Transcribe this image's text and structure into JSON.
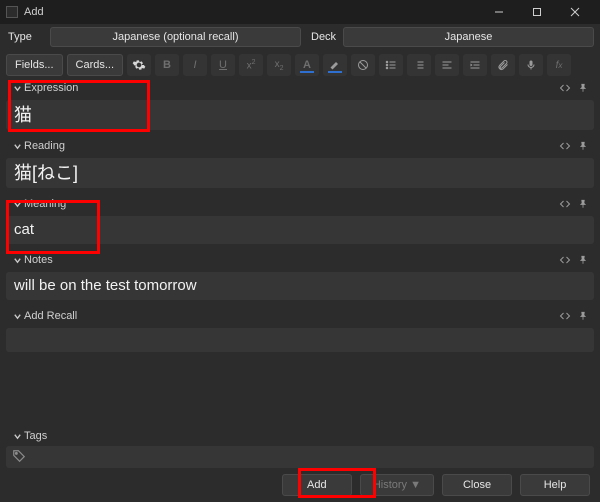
{
  "window": {
    "title": "Add",
    "min_tooltip": "Minimize",
    "max_tooltip": "Maximize",
    "close_tooltip": "Close"
  },
  "typedeck": {
    "type_label": "Type",
    "type_value": "Japanese (optional recall)",
    "deck_label": "Deck",
    "deck_value": "Japanese"
  },
  "toolbar": {
    "fields_label": "Fields...",
    "cards_label": "Cards...",
    "icons": {
      "settings": "gear",
      "bold": "B",
      "italic": "I",
      "underline": "U",
      "super": "x²",
      "sub": "x₂",
      "textcolor": "A",
      "highlight": "✎",
      "eraser": "eraser",
      "ul": "ul",
      "ol": "ol",
      "align": "align",
      "indent": "indent",
      "attach": "clip",
      "mic": "mic",
      "fx": "fx"
    }
  },
  "fields": [
    {
      "label": "Expression",
      "value": "猫",
      "jp": true
    },
    {
      "label": "Reading",
      "value": "猫[ねこ]",
      "jp": true
    },
    {
      "label": "Meaning",
      "value": "cat",
      "jp": false
    },
    {
      "label": "Notes",
      "value": "will be on the test tomorrow",
      "jp": false
    },
    {
      "label": "Add Recall",
      "value": "",
      "jp": false
    }
  ],
  "tags": {
    "label": "Tags",
    "placeholder": ""
  },
  "buttons": {
    "add": "Add",
    "history": "History ▼",
    "close": "Close",
    "help": "Help"
  }
}
